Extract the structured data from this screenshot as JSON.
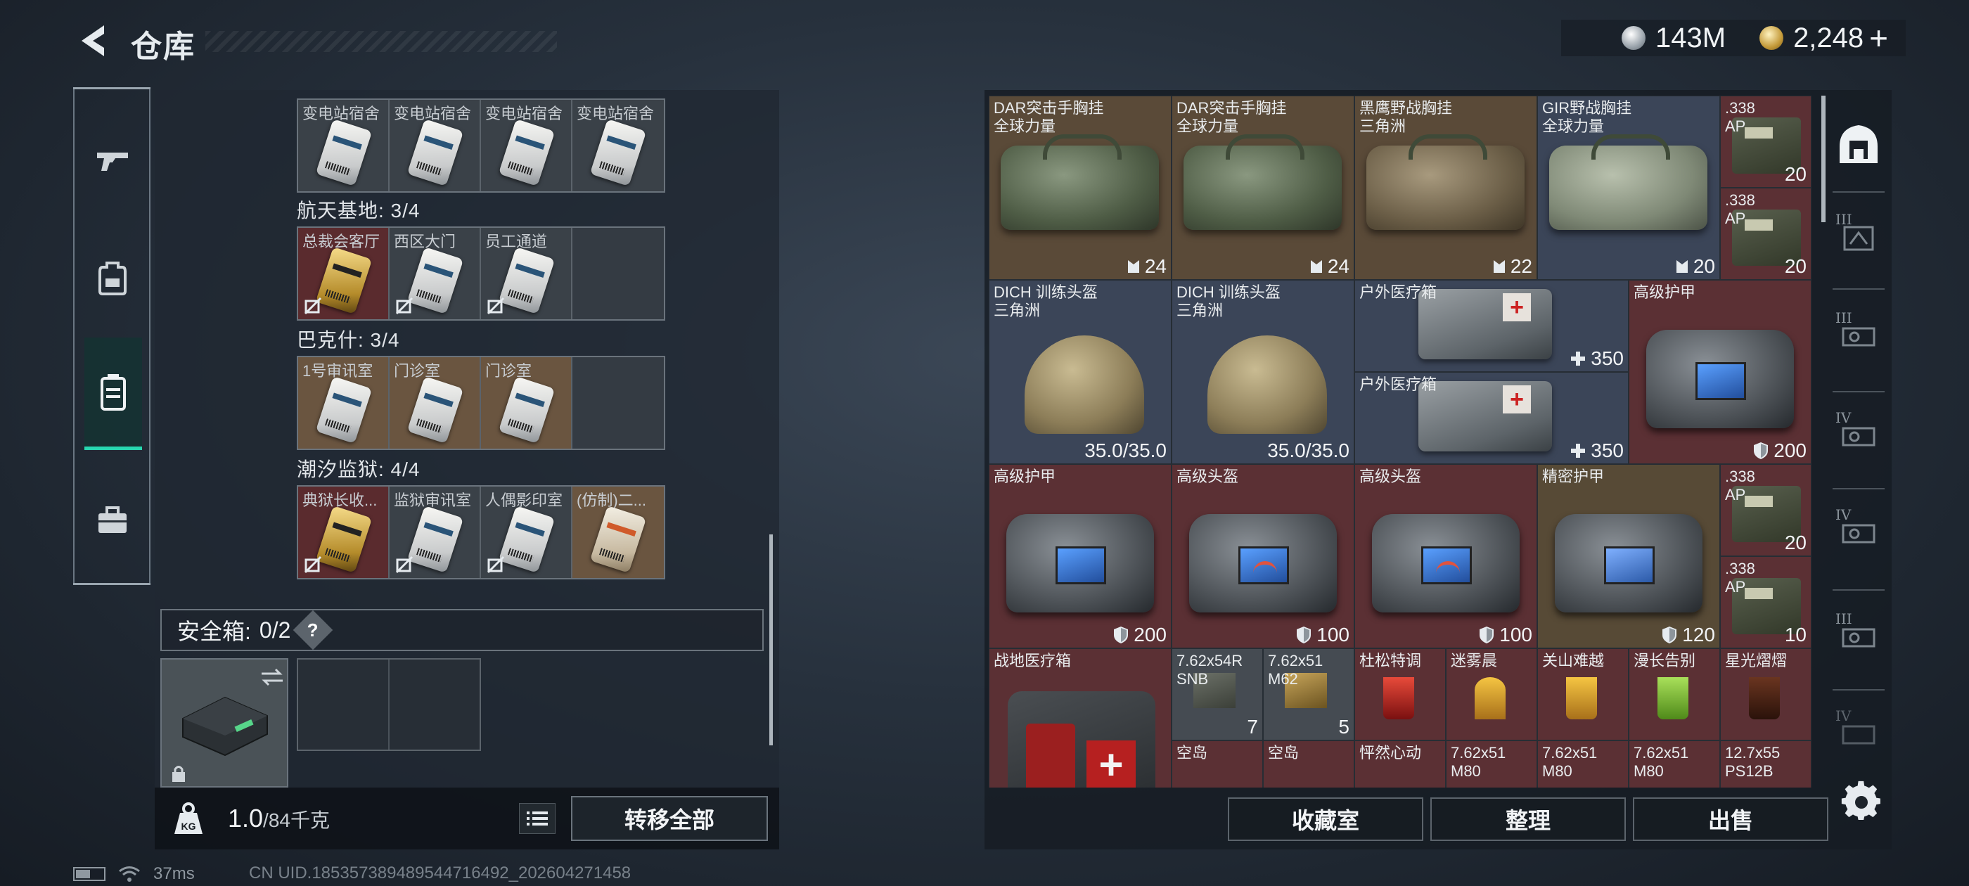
{
  "header": {
    "title": "仓库"
  },
  "currency": {
    "silver_amount": "143M",
    "gold_amount": "2,248",
    "add_label": "+"
  },
  "left_tabs": [
    {
      "icon": "gun-icon",
      "active": false
    },
    {
      "icon": "backpack-icon",
      "active": false
    },
    {
      "icon": "container-icon",
      "active": true
    },
    {
      "icon": "toolbox-icon",
      "active": false
    }
  ],
  "key_groups": [
    {
      "title": "",
      "cells": [
        "变电站宿舍",
        "变电站宿舍",
        "变电站宿舍",
        "变电站宿舍"
      ]
    },
    {
      "title": "航天基地: 3/4",
      "cells": [
        "总裁会客厅",
        "西区大门",
        "员工通道",
        ""
      ]
    },
    {
      "title": "巴克什: 3/4",
      "cells": [
        "1号审讯室",
        "门诊室",
        "门诊室",
        ""
      ]
    },
    {
      "title": "潮汐监狱: 4/4",
      "cells": [
        "典狱长收...",
        "监狱审讯室",
        "人偶影印室",
        "(仿制)二..."
      ]
    }
  ],
  "safe_box": {
    "label": "安全箱:",
    "count": "0/2",
    "help": "?"
  },
  "weight": {
    "current": "1.0",
    "max": "/84千克",
    "kg_label": "KG"
  },
  "transfer_all": "转移全部",
  "warehouse": {
    "items": [
      {
        "name": "DAR突击手胸挂\n全球力量",
        "stat": "24",
        "stat_icon": "capacity-icon"
      },
      {
        "name": "DAR突击手胸挂\n全球力量",
        "stat": "24",
        "stat_icon": "capacity-icon"
      },
      {
        "name": "黑鹰野战胸挂\n三角洲",
        "stat": "22",
        "stat_icon": "capacity-icon"
      },
      {
        "name": "GIR野战胸挂\n全球力量",
        "stat": "20",
        "stat_icon": "capacity-icon"
      },
      {
        "name": ".338\nAP",
        "stat": "20"
      },
      {
        "name": ".338\nAP",
        "stat": "20"
      },
      {
        "name": "DICH 训练头盔\n三角洲",
        "stat": "35.0/35.0"
      },
      {
        "name": "DICH 训练头盔\n三角洲",
        "stat": "35.0/35.0"
      },
      {
        "name": "户外医疗箱",
        "stat": "350",
        "stat_icon": "plus-icon"
      },
      {
        "name": "户外医疗箱",
        "stat": "350",
        "stat_icon": "plus-icon"
      },
      {
        "name": "高级护甲",
        "stat": "200",
        "stat_icon": "shield-icon"
      },
      {
        "name": "高级护甲",
        "stat": "200",
        "stat_icon": "shield-icon"
      },
      {
        "name": "高级头盔",
        "stat": "100",
        "stat_icon": "shield-icon"
      },
      {
        "name": "高级头盔",
        "stat": "100",
        "stat_icon": "shield-icon"
      },
      {
        "name": "精密护甲",
        "stat": "120",
        "stat_icon": "shield-icon"
      },
      {
        "name": ".338\nAP",
        "stat": "20"
      },
      {
        "name": ".338\nAP",
        "stat": "10"
      },
      {
        "name": "战地医疗箱",
        "stat": ""
      },
      {
        "name": "7.62x54R\nSNB",
        "stat": "7"
      },
      {
        "name": "7.62x51\nM62",
        "stat": "5"
      },
      {
        "name": "杜松特调",
        "stat": ""
      },
      {
        "name": "迷雾晨",
        "stat": ""
      },
      {
        "name": "关山难越",
        "stat": ""
      },
      {
        "name": "漫长告别",
        "stat": ""
      },
      {
        "name": "星光熠熠",
        "stat": ""
      },
      {
        "name": "空岛",
        "stat": ""
      },
      {
        "name": "空岛",
        "stat": ""
      },
      {
        "name": "怦然心动",
        "stat": ""
      },
      {
        "name": "7.62x51\nM80",
        "stat": ""
      },
      {
        "name": "7.62x51\nM80",
        "stat": ""
      },
      {
        "name": "7.62x51\nM80",
        "stat": ""
      },
      {
        "name": "12.7x55\nPS12B",
        "stat": ""
      }
    ]
  },
  "right_tabs": [
    {
      "icon": "storage-icon",
      "tier": ""
    },
    {
      "icon": "ammo-crate-icon",
      "tier": "III"
    },
    {
      "icon": "gun-case-icon",
      "tier": "III"
    },
    {
      "icon": "gun-case-icon",
      "tier": "IV"
    },
    {
      "icon": "gun-case-icon",
      "tier": "IV"
    },
    {
      "icon": "gun-case-icon",
      "tier": "III"
    },
    {
      "icon": "gun-case-icon",
      "tier": "IV"
    }
  ],
  "bottom_buttons": {
    "collection": "收藏室",
    "organize": "整理",
    "sell": "出售"
  },
  "status": {
    "ping": "37ms",
    "uid": "CN UID.1853573894895447164​92_202604271458"
  }
}
